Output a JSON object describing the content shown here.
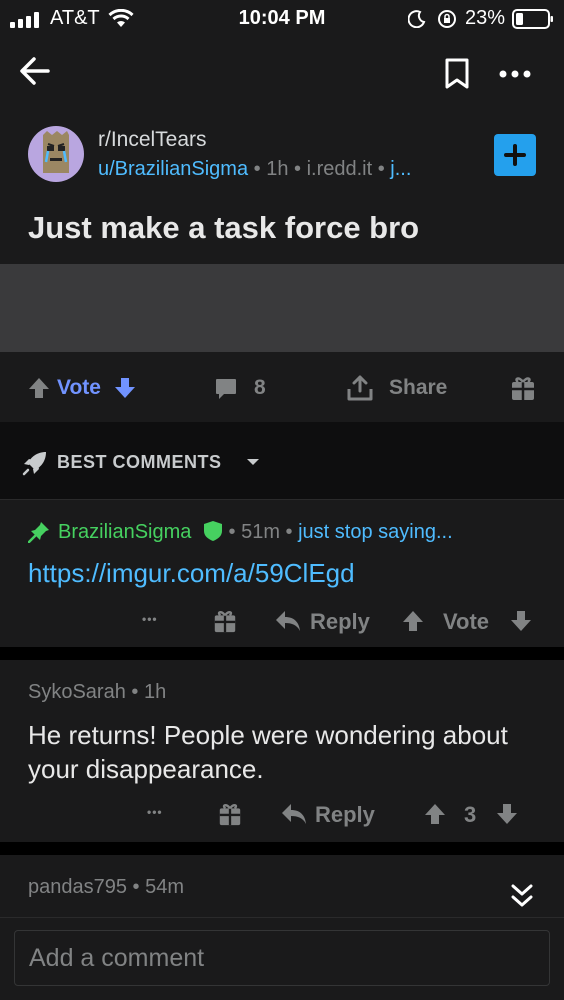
{
  "status_bar": {
    "carrier": "AT&T",
    "time": "10:04 PM",
    "battery": "23%"
  },
  "post": {
    "subreddit": "r/IncelTears",
    "author": "u/BrazilianSigma",
    "age": "1h",
    "domain": "i.redd.it",
    "domain_extra": "j...",
    "title": "Just make a task force bro"
  },
  "post_actions": {
    "vote_label": "Vote",
    "comment_count": "8",
    "share_label": "Share"
  },
  "sort": {
    "label": "BEST COMMENTS"
  },
  "comments": [
    {
      "author": "BrazilianSigma",
      "age": "51m",
      "flair": "just stop saying...",
      "body": "https://imgur.com/a/59ClEgd",
      "dots": "•••",
      "reply_label": "Reply",
      "vote_label": "Vote"
    },
    {
      "author": "SykoSarah",
      "age": "1h",
      "body": "He returns! People were wondering about your disappearance.",
      "dots": "•••",
      "reply_label": "Reply",
      "score": "3"
    },
    {
      "author": "pandas795",
      "age": "54m"
    }
  ],
  "composer": {
    "placeholder": "Add a comment"
  },
  "colors": {
    "link_blue": "#4fbcff",
    "mod_green": "#46d160",
    "upvote_blue": "#7193ff",
    "join_blue": "#24a0ed"
  },
  "icons": [
    "back-arrow-icon",
    "bookmark-icon",
    "more-icon",
    "plus-icon",
    "upvote-icon",
    "downvote-icon",
    "comment-icon",
    "share-icon",
    "gift-icon",
    "rocket-icon",
    "chevron-down-icon",
    "pin-icon",
    "shield-icon",
    "reply-icon",
    "double-chevron-icon"
  ]
}
